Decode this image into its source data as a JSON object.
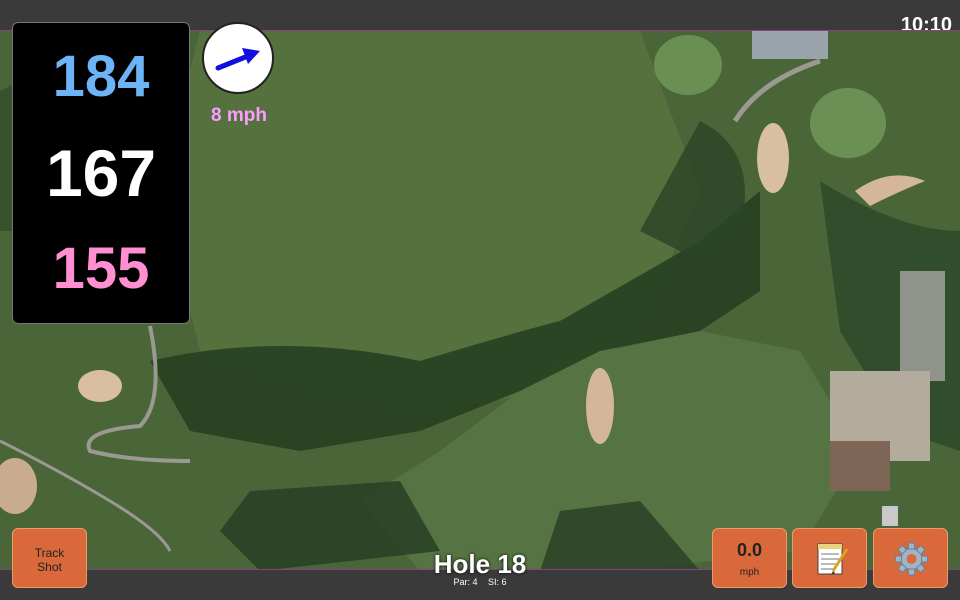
{
  "status": {
    "time": "10:10"
  },
  "yardage": {
    "back": "184",
    "middle": "167",
    "front": "155",
    "colors": {
      "back": "#6cb4f5",
      "middle": "#ffffff",
      "front": "#ff8fd1"
    }
  },
  "wind": {
    "speed_label": "8 mph",
    "icon": "wind-arrow-icon",
    "arrow_color": "#1010e0"
  },
  "hole": {
    "title": "Hole 18",
    "par_label": "Par: 4",
    "si_label": "SI: 6"
  },
  "buttons": {
    "track_line1": "Track",
    "track_line2": "Shot",
    "speed_value": "0.0",
    "speed_unit": "mph",
    "notes_icon": "notepad-icon",
    "settings_icon": "gear-icon",
    "accent": "#d9683a"
  }
}
